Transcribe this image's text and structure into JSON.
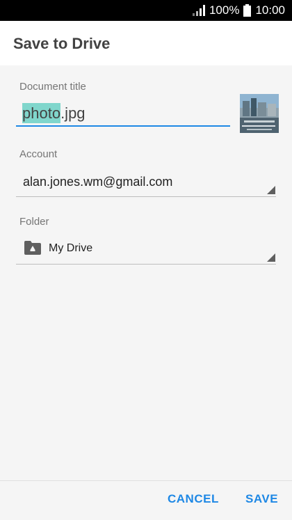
{
  "status_bar": {
    "battery_text": "100%",
    "time": "10:00"
  },
  "header": {
    "title": "Save to Drive"
  },
  "form": {
    "document_title_label": "Document title",
    "document_title_selected": "photo",
    "document_title_extension": ".jpg",
    "account_label": "Account",
    "account_value": "alan.jones.wm@gmail.com",
    "folder_label": "Folder",
    "folder_value": "My Drive"
  },
  "footer": {
    "cancel_label": "CANCEL",
    "save_label": "SAVE"
  },
  "colors": {
    "accent": "#1e88e5",
    "selection": "#80d6cc",
    "header_bg": "#ffffff",
    "body_bg": "#f5f5f5"
  },
  "icons": [
    "signal-icon",
    "battery-icon",
    "folder-drive-icon",
    "dropdown-arrow-icon"
  ]
}
